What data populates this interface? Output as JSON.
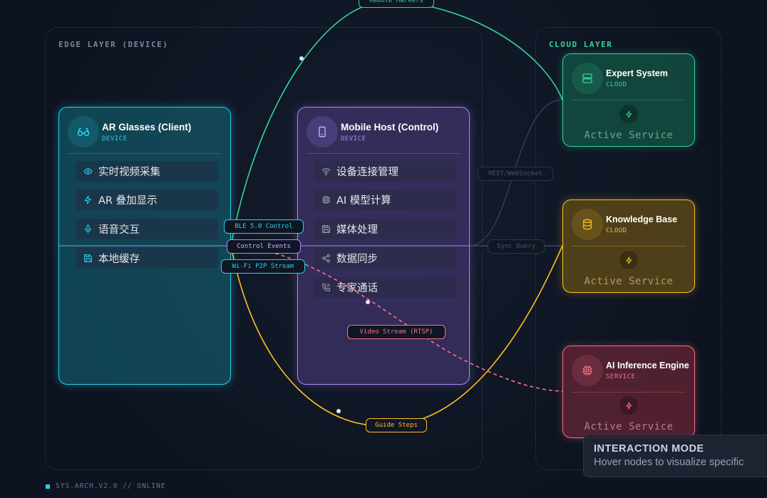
{
  "layers": {
    "edge": {
      "title": "EDGE LAYER (DEVICE)"
    },
    "cloud": {
      "title": "CLOUD LAYER"
    }
  },
  "colors": {
    "cyan": "#22d3ee",
    "purple": "#a78bfa",
    "green": "#34d399",
    "amber": "#fbbf24",
    "rose": "#f87185",
    "status_square": "#22d3ee"
  },
  "nodes": {
    "ar_glasses": {
      "title": "AR Glasses (Client)",
      "subtitle": "DEVICE",
      "icon": "glasses-icon",
      "items": [
        {
          "label": "实时视频采集",
          "icon": "eye-icon"
        },
        {
          "label": "AR 叠加显示",
          "icon": "zap-icon"
        },
        {
          "label": "语音交互",
          "icon": "mic-icon"
        },
        {
          "label": "本地缓存",
          "icon": "save-icon"
        }
      ]
    },
    "mobile_host": {
      "title": "Mobile Host (Control)",
      "subtitle": "DEVICE",
      "icon": "smartphone-icon",
      "items": [
        {
          "label": "设备连接管理",
          "icon": "wifi-icon"
        },
        {
          "label": "AI 模型计算",
          "icon": "cpu-icon"
        },
        {
          "label": "媒体处理",
          "icon": "save-icon"
        },
        {
          "label": "数据同步",
          "icon": "share-icon"
        },
        {
          "label": "专家通话",
          "icon": "phone-call-icon"
        }
      ]
    },
    "expert_system": {
      "title": "Expert System",
      "subtitle": "CLOUD",
      "icon": "server-icon",
      "footer": "Active Service"
    },
    "knowledge_base": {
      "title": "Knowledge Base",
      "subtitle": "CLOUD",
      "icon": "database-icon",
      "footer": "Active Service"
    },
    "ai_inference": {
      "title": "AI Inference Engine",
      "subtitle": "SERVICE",
      "icon": "chip-icon",
      "footer": "Active Service"
    }
  },
  "connections": {
    "remote_markers": "Remote Markers",
    "ble_control": "BLE 5.0 Control",
    "control_events": "Control Events",
    "wifi_p2p": "Wi-Fi P2P Stream",
    "rest_websocket": "REST/WebSocket",
    "sync_query": "Sync Query",
    "video_stream": "Video Stream (RTSP)",
    "guide_steps": "Guide Steps"
  },
  "status": {
    "text": "SYS.ARCH.V2.0 // ONLINE"
  },
  "tooltip": {
    "title": "INTERACTION MODE",
    "text": "Hover nodes to visualize specific"
  }
}
